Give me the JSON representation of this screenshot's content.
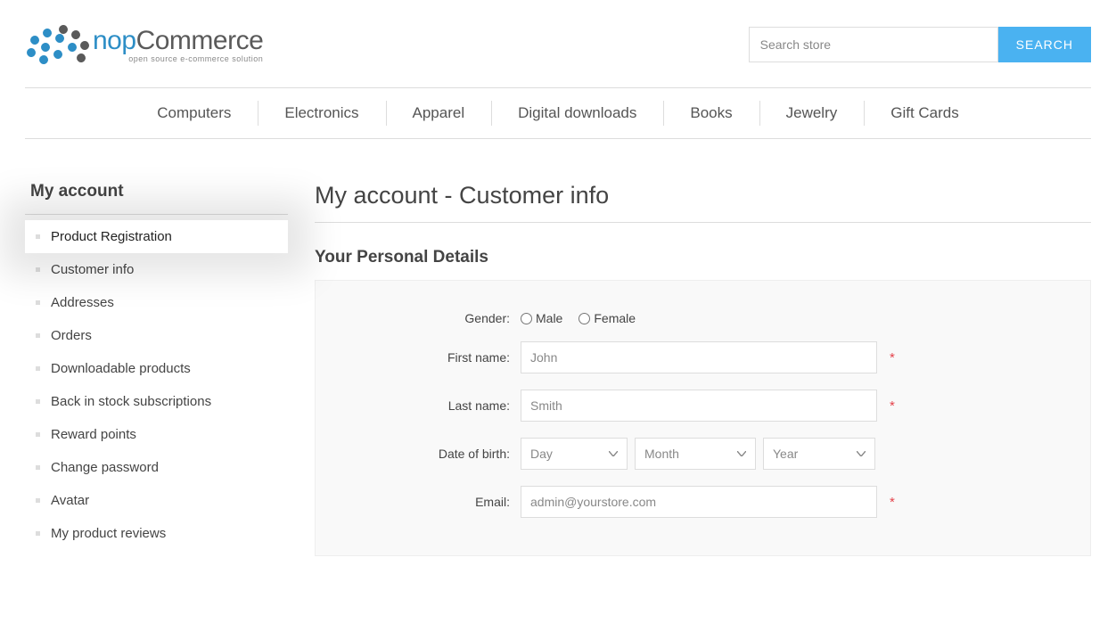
{
  "header": {
    "logo_nop": "nop",
    "logo_commerce": "Commerce",
    "logo_sub": "open source e-commerce solution",
    "search_placeholder": "Search store",
    "search_button": "SEARCH"
  },
  "nav": {
    "items": [
      "Computers",
      "Electronics",
      "Apparel",
      "Digital downloads",
      "Books",
      "Jewelry",
      "Gift Cards"
    ]
  },
  "sidebar": {
    "title": "My account",
    "items": [
      "Product Registration",
      "Customer info",
      "Addresses",
      "Orders",
      "Downloadable products",
      "Back in stock subscriptions",
      "Reward points",
      "Change password",
      "Avatar",
      "My product reviews"
    ],
    "selected_index": 0
  },
  "main": {
    "page_title": "My account - Customer info",
    "section_title": "Your Personal Details",
    "labels": {
      "gender": "Gender:",
      "male": "Male",
      "female": "Female",
      "first_name": "First name:",
      "last_name": "Last name:",
      "dob": "Date of birth:",
      "day": "Day",
      "month": "Month",
      "year": "Year",
      "email": "Email:"
    },
    "values": {
      "first_name": "John",
      "last_name": "Smith",
      "email": "admin@yourstore.com"
    }
  }
}
